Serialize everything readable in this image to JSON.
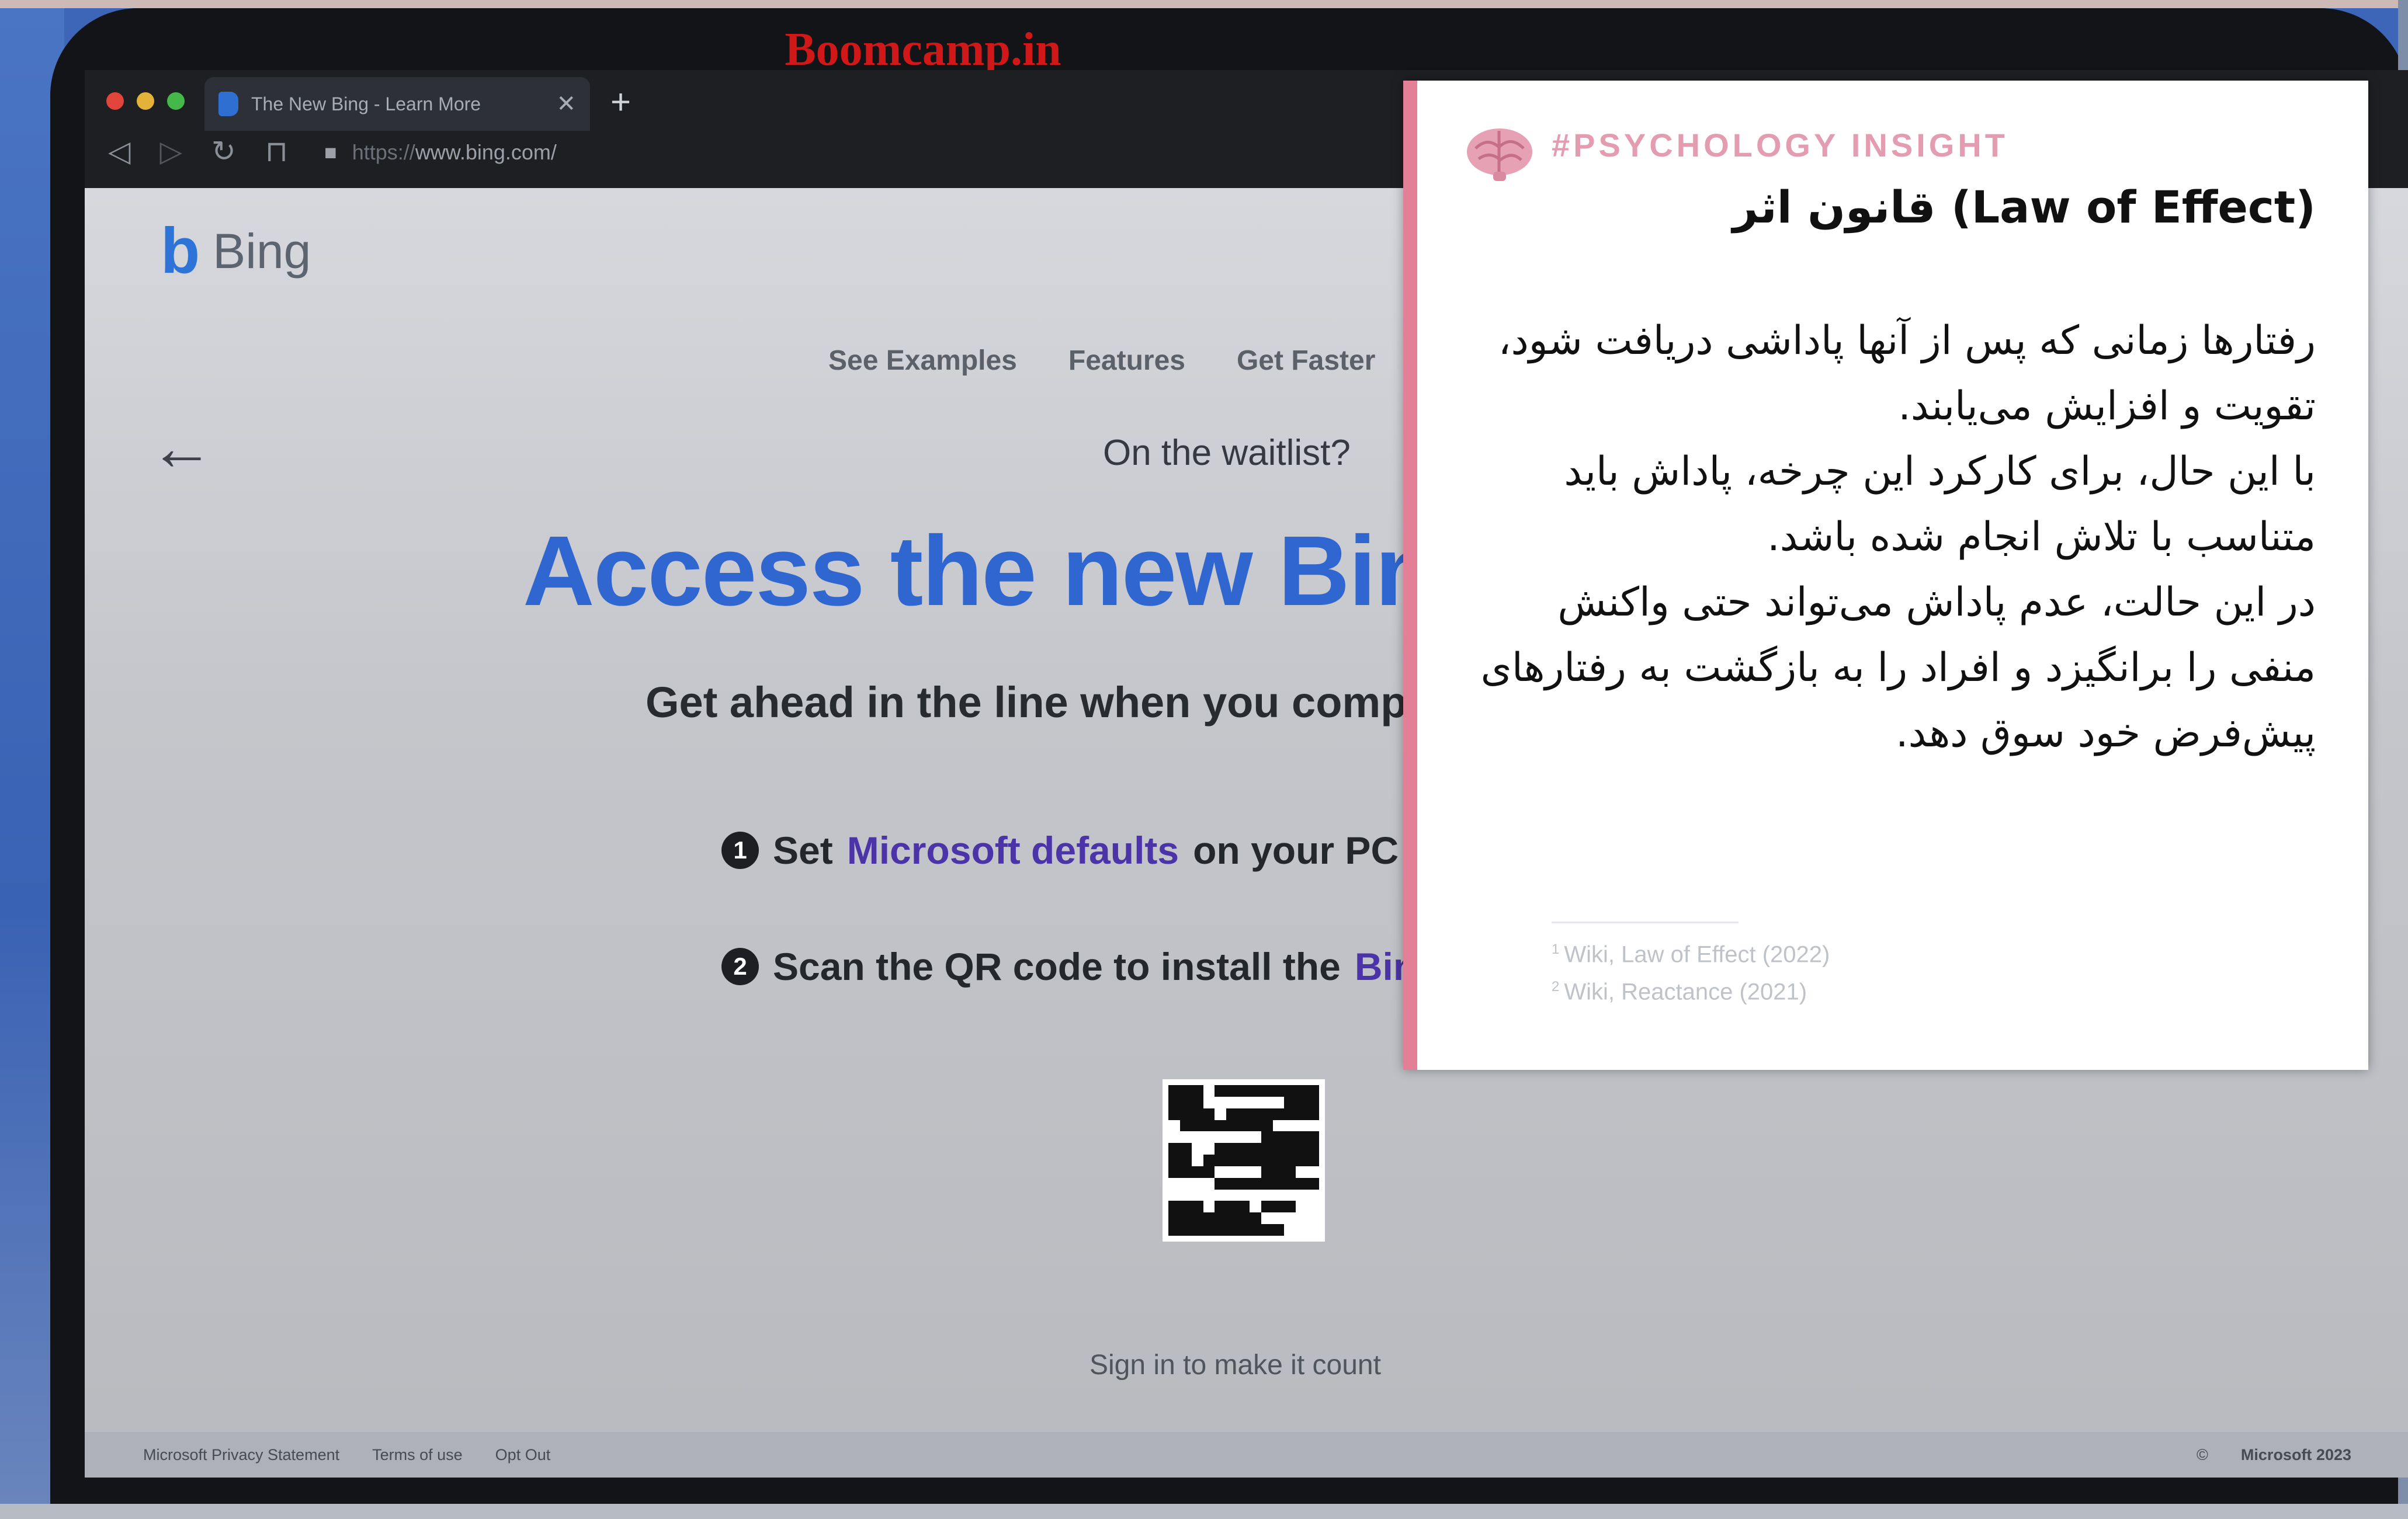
{
  "watermark": "Boomcamp.in",
  "browser": {
    "tab_title": "The New Bing - Learn More",
    "tab_close": "✕",
    "new_tab": "+",
    "url_scheme": "https://",
    "url_host": "www.bing.com/"
  },
  "bing": {
    "logo_word": "Bing",
    "nav": [
      "See Examples",
      "Features",
      "Get Faster"
    ],
    "waitlist": "On the waitlist?",
    "headline": "Access the new Bing",
    "subhead": "Get ahead in the line when you complete the following",
    "steps": [
      {
        "num": "1",
        "before": "Set",
        "link": "Microsoft defaults",
        "after": "on your PC"
      },
      {
        "num": "2",
        "before": "Scan the QR code to install the",
        "link": "Bing",
        "after": ""
      }
    ],
    "signin": "Sign in to make it count",
    "footer": {
      "privacy": "Microsoft Privacy Statement",
      "terms": "Terms of use",
      "opt_out": "Opt Out",
      "copyright": "Microsoft 2023"
    }
  },
  "card": {
    "tag": "#PSYCHOLOGY INSIGHT",
    "title": "قانون اثر (Law of Effect)",
    "paragraphs": [
      "رفتارها زمانی که پس از آنها پاداشی دریافت شود، تقویت و افزایش می‌یابند.",
      "با این حال، برای کارکرد این چرخه، پاداش باید متناسب با تلاش انجام شده باشد.",
      "در این حالت، عدم پاداش می‌تواند حتی واکنش منفی را برانگیزد و افراد را به بازگشت به رفتارهای پیش‌فرض خود سوق دهد."
    ],
    "references": [
      {
        "num": "1",
        "text": "Wiki, Law of Effect (2022)"
      },
      {
        "num": "2",
        "text": "Wiki, Reactance (2021)"
      }
    ]
  }
}
